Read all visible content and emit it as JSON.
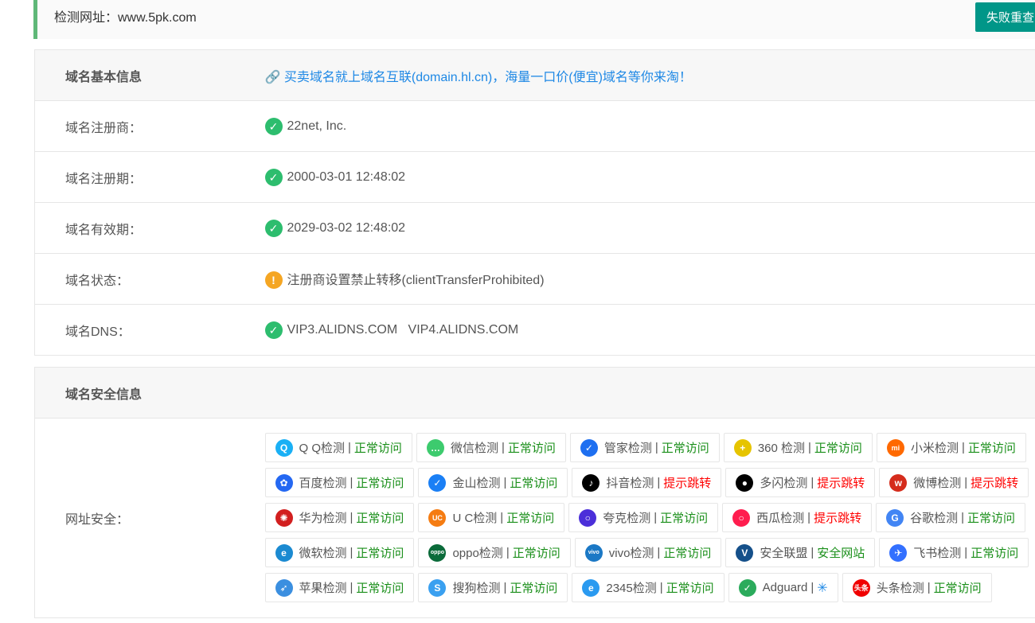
{
  "top": {
    "url_label": "检测网址：www.5pk.com",
    "retry_button": "失败重查"
  },
  "basic": {
    "title": "域名基本信息",
    "ad": "买卖域名就上域名互联(domain.hl.cn)，海量一口价(便宜)域名等你来淘！",
    "rows": [
      {
        "label": "域名注册商：",
        "value": "22net, Inc.",
        "status": "ok"
      },
      {
        "label": "域名注册期：",
        "value": "2000-03-01 12:48:02",
        "status": "ok"
      },
      {
        "label": "域名有效期：",
        "value": "2029-03-02 12:48:02",
        "status": "ok"
      },
      {
        "label": "域名状态：",
        "value": "注册商设置禁止转移(clientTransferProhibited)",
        "status": "warn"
      },
      {
        "label": "域名DNS：",
        "value": "VIP3.ALIDNS.COM   VIP4.ALIDNS.COM",
        "status": "ok"
      }
    ]
  },
  "security": {
    "title": "域名安全信息",
    "label": "网址安全：",
    "checks": [
      {
        "name": "Q Q检测",
        "result": "正常访问",
        "state": "good",
        "icon": "qq-icon",
        "color": "#1ab0f5",
        "glyph": "Q"
      },
      {
        "name": "微信检测",
        "result": "正常访问",
        "state": "good",
        "icon": "wechat-icon",
        "color": "#3dcb6e",
        "glyph": "…"
      },
      {
        "name": "管家检测",
        "result": "正常访问",
        "state": "good",
        "icon": "guanjia-icon",
        "color": "#1e6ff0",
        "glyph": "✓"
      },
      {
        "name": "360 检测",
        "result": "正常访问",
        "state": "good",
        "icon": "360-icon",
        "color": "#e6c400",
        "glyph": "+"
      },
      {
        "name": "小米检测",
        "result": "正常访问",
        "state": "good",
        "icon": "xiaomi-icon",
        "color": "#ff6900",
        "glyph": "mi"
      },
      {
        "name": "百度检测",
        "result": "正常访问",
        "state": "good",
        "icon": "baidu-icon",
        "color": "#2468f2",
        "glyph": "✿"
      },
      {
        "name": "金山检测",
        "result": "正常访问",
        "state": "good",
        "icon": "jinshan-icon",
        "color": "#1a7ff5",
        "glyph": "✓"
      },
      {
        "name": "抖音检测",
        "result": "提示跳转",
        "state": "bad",
        "icon": "douyin-icon",
        "color": "#000000",
        "glyph": "♪"
      },
      {
        "name": "多闪检测",
        "result": "提示跳转",
        "state": "bad",
        "icon": "duoshan-icon",
        "color": "#000000",
        "glyph": "●"
      },
      {
        "name": "微博检测",
        "result": "提示跳转",
        "state": "bad",
        "icon": "weibo-icon",
        "color": "#d52c1c",
        "glyph": "w"
      },
      {
        "name": "华为检测",
        "result": "正常访问",
        "state": "good",
        "icon": "huawei-icon",
        "color": "#d21f1f",
        "glyph": "✺"
      },
      {
        "name": "U C检测",
        "result": "正常访问",
        "state": "good",
        "icon": "uc-icon",
        "color": "#f57c12",
        "glyph": "UC"
      },
      {
        "name": "夸克检测",
        "result": "正常访问",
        "state": "good",
        "icon": "quark-icon",
        "color": "#4b2fd9",
        "glyph": "○"
      },
      {
        "name": "西瓜检测",
        "result": "提示跳转",
        "state": "bad",
        "icon": "xigua-icon",
        "color": "#ff1d4e",
        "glyph": "○"
      },
      {
        "name": "谷歌检测",
        "result": "正常访问",
        "state": "good",
        "icon": "google-icon",
        "color": "#4285f4",
        "glyph": "G"
      },
      {
        "name": "微软检测",
        "result": "正常访问",
        "state": "good",
        "icon": "edge-icon",
        "color": "#1b8ad1",
        "glyph": "e"
      },
      {
        "name": "oppo检测",
        "result": "正常访问",
        "state": "good",
        "icon": "oppo-icon",
        "color": "#0b6b3a",
        "glyph": "oppo"
      },
      {
        "name": "vivo检测",
        "result": "正常访问",
        "state": "good",
        "icon": "vivo-icon",
        "color": "#1b78c5",
        "glyph": "vivo"
      },
      {
        "name": "安全联盟",
        "result": "安全网站",
        "state": "good",
        "icon": "anquanlianmeng-icon",
        "color": "#15508a",
        "glyph": "V"
      },
      {
        "name": "飞书检测",
        "result": "正常访问",
        "state": "good",
        "icon": "feishu-icon",
        "color": "#3370ff",
        "glyph": "✈"
      },
      {
        "name": "苹果检测",
        "result": "正常访问",
        "state": "good",
        "icon": "safari-icon",
        "color": "#3b8fe0",
        "glyph": "➶"
      },
      {
        "name": "搜狗检测",
        "result": "正常访问",
        "state": "good",
        "icon": "sogou-icon",
        "color": "#3aa0f0",
        "glyph": "S"
      },
      {
        "name": "2345检测",
        "result": "正常访问",
        "state": "good",
        "icon": "2345-icon",
        "color": "#2a9af0",
        "glyph": "e"
      },
      {
        "name": "Adguard",
        "result": "",
        "state": "loading",
        "icon": "adguard-icon",
        "color": "#2bab5c",
        "glyph": "✓"
      },
      {
        "name": "头条检测",
        "result": "正常访问",
        "state": "good",
        "icon": "toutiao-icon",
        "color": "#f00000",
        "glyph": "头条"
      }
    ]
  }
}
